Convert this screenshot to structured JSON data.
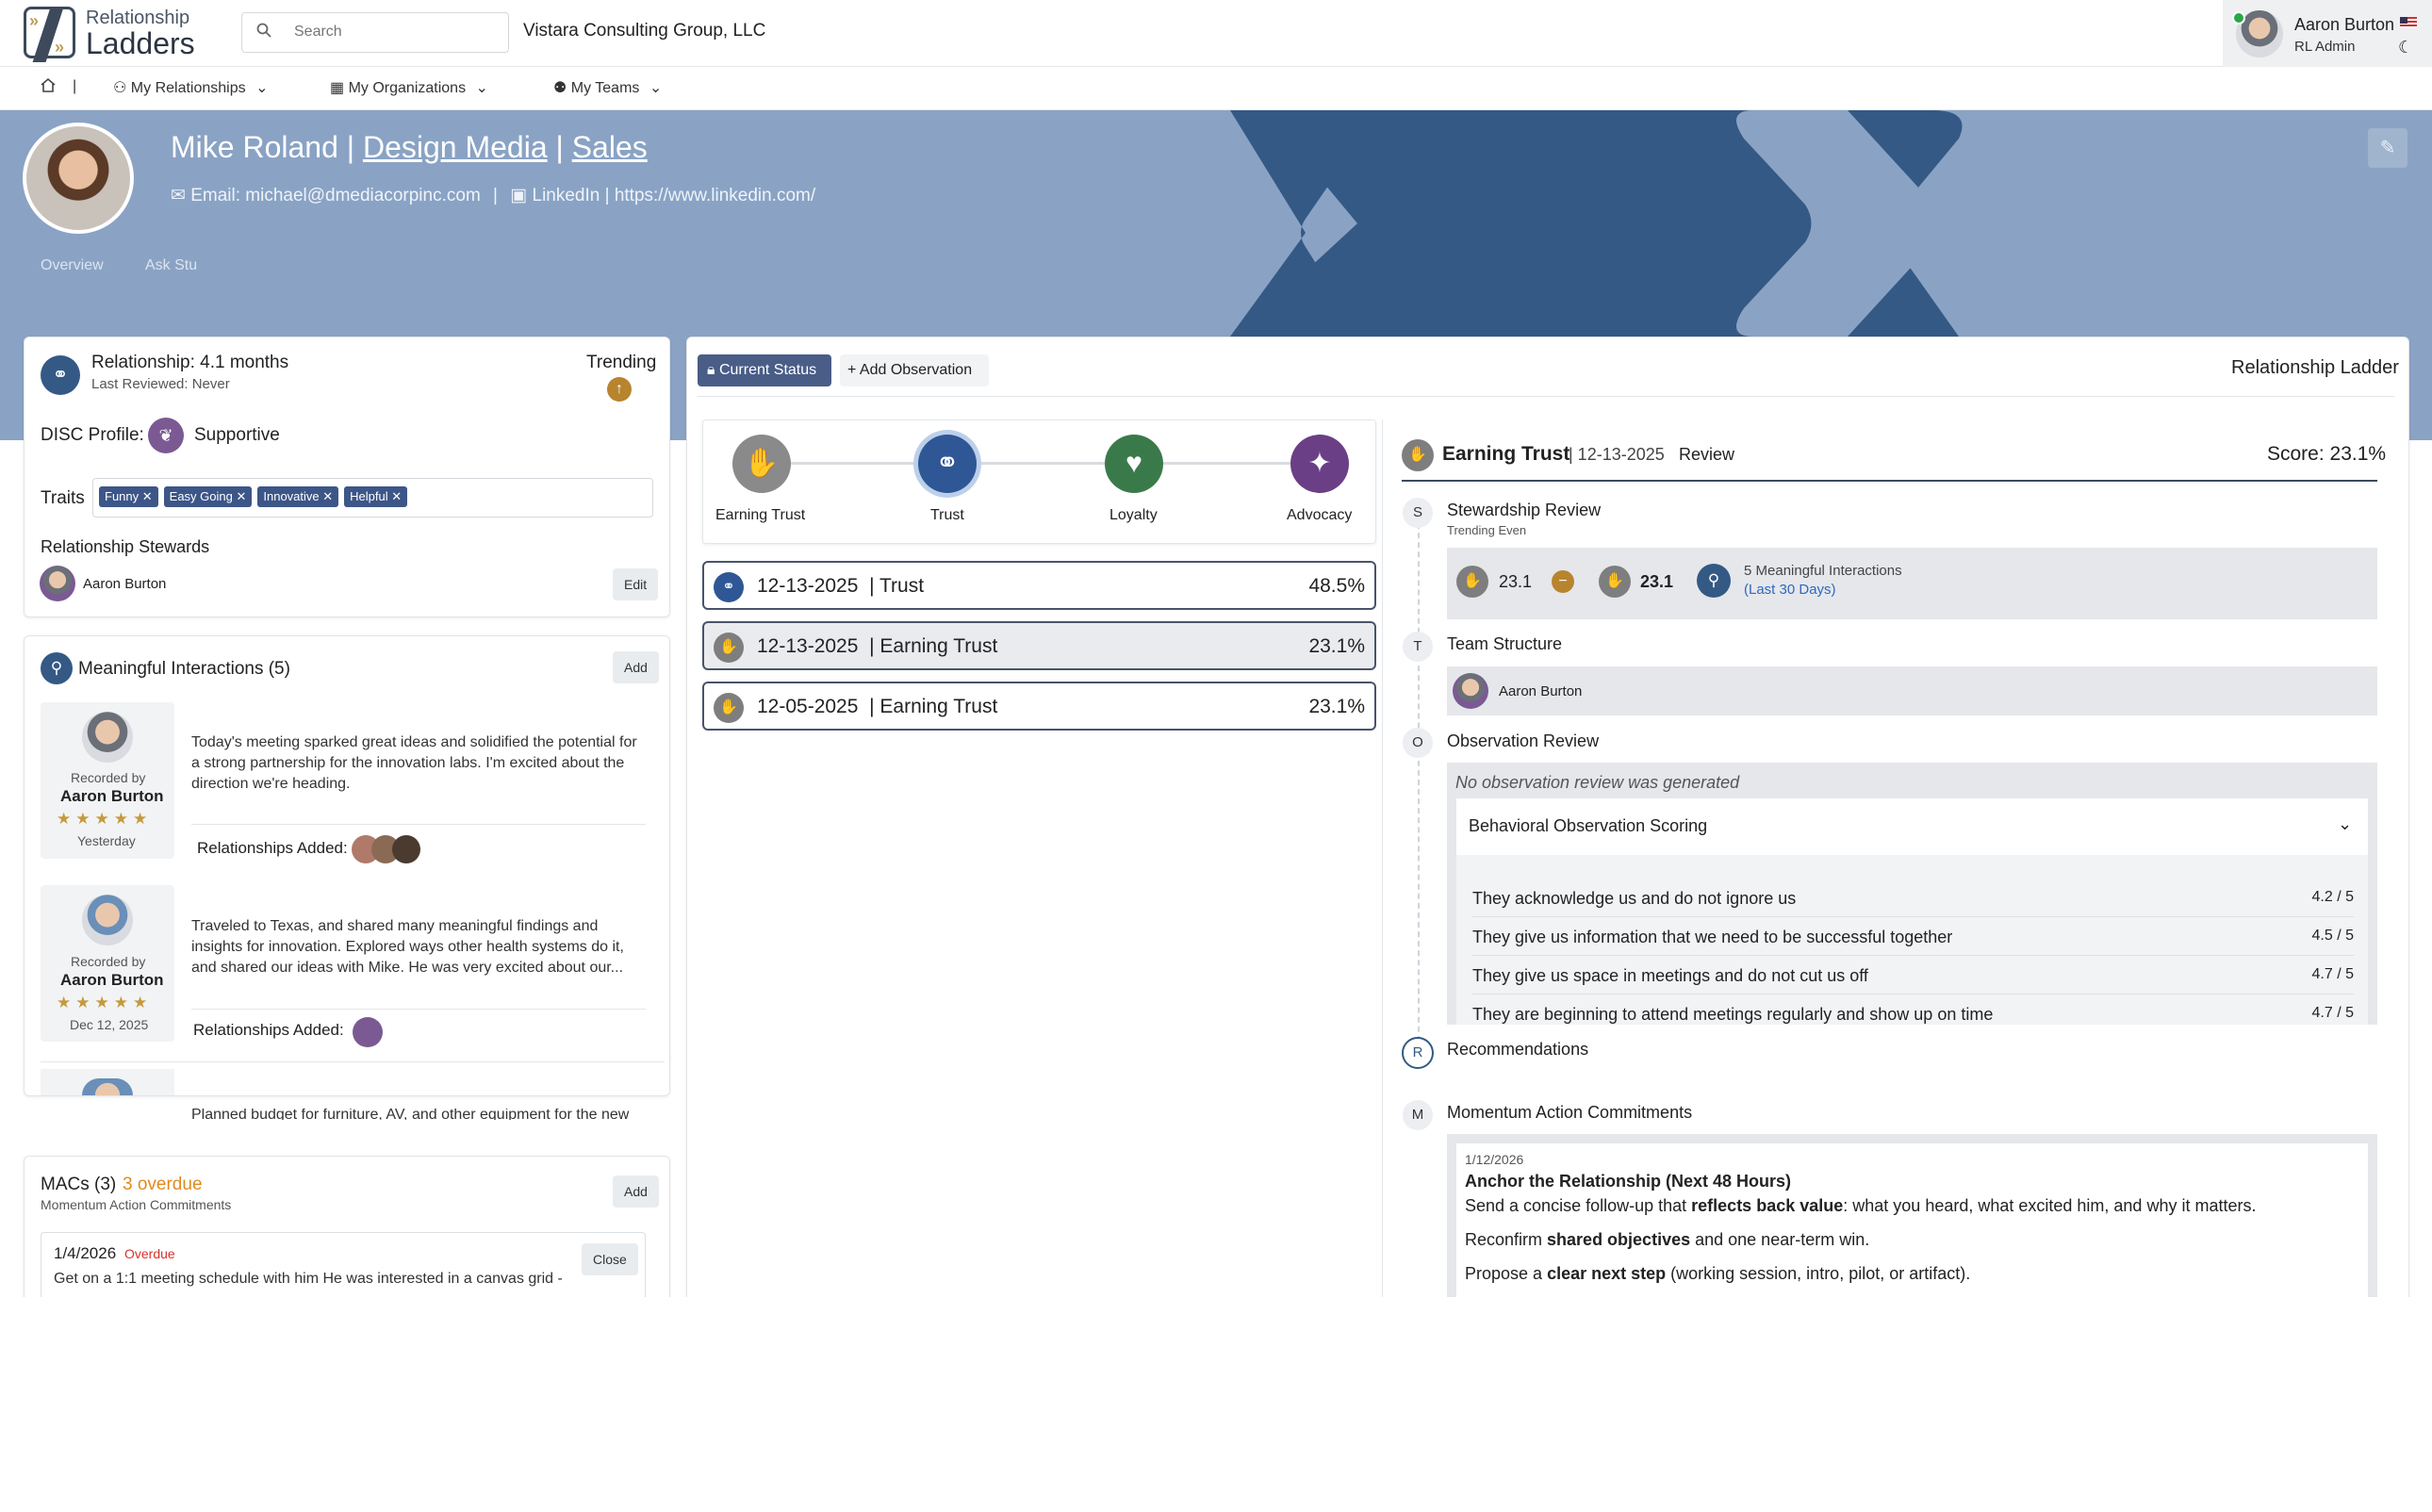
{
  "app": {
    "logo_line1": "Relationship",
    "logo_line2": "Ladders"
  },
  "search": {
    "placeholder": "Search"
  },
  "org_name": "Vistara Consulting Group, LLC",
  "user": {
    "name": "Aaron Burton",
    "role": "RL Admin"
  },
  "nav": {
    "separator": "|",
    "items": [
      "My Relationships",
      "My Organizations",
      "My Teams"
    ]
  },
  "profile": {
    "name": "Mike Roland",
    "company": "Design Media",
    "department": "Sales",
    "email": "Email: michael@dmediacorpinc.com",
    "linkedin": "LinkedIn | https://www.linkedin.com/",
    "tabs": [
      "Overview",
      "Ask Stu"
    ]
  },
  "summary": {
    "relationship": "Relationship: 4.1 months",
    "last_reviewed": "Last Reviewed: Never",
    "trending": "Trending",
    "disc_label": "DISC Profile:",
    "disc_value": "Supportive",
    "traits_label": "Traits",
    "traits": [
      "Funny",
      "Easy Going",
      "Innovative",
      "Helpful"
    ],
    "stewards_label": "Relationship Stewards",
    "steward": "Aaron Burton",
    "edit": "Edit"
  },
  "interactions": {
    "title": "Meaningful Interactions (5)",
    "add": "Add",
    "items": [
      {
        "recorded_by": "Recorded by",
        "author": "Aaron Burton",
        "stars": "★★★★★",
        "date": "Yesterday",
        "text": "Today's meeting sparked great ideas and solidified the potential for a strong partnership for the innovation labs. I'm excited about the direction we're heading.",
        "rel_label": "Relationships Added:"
      },
      {
        "recorded_by": "Recorded by",
        "author": "Aaron Burton",
        "stars": "★★★★★",
        "date": "Dec 12, 2025",
        "text": "Traveled to Texas, and shared many meaningful findings and insights for innovation. Explored ways other health systems do it, and shared our ideas with Mike. He was very excited about our...",
        "rel_label": "Relationships Added:"
      },
      {
        "text": "Planned budget for furniture, AV, and other equipment for the new"
      }
    ]
  },
  "macs": {
    "title": "MACs (3)",
    "overdue_count": "3 overdue",
    "subtitle": "Momentum Action Commitments",
    "add": "Add",
    "item_date": "1/4/2026",
    "item_status": "Overdue",
    "item_text": "Get on a 1:1 meeting schedule with him He was interested in a canvas grid -",
    "close": "Close"
  },
  "ladder": {
    "current_status": "Current Status",
    "add_observation": "Add Observation",
    "title": "Relationship Ladder",
    "stages": [
      "Earning Trust",
      "Trust",
      "Loyalty",
      "Advocacy"
    ],
    "history": [
      {
        "date": "12-13-2025",
        "stage": "| Trust",
        "pct": "48.5%"
      },
      {
        "date": "12-13-2025",
        "stage": "| Earning Trust",
        "pct": "23.1%"
      },
      {
        "date": "12-05-2025",
        "stage": "| Earning Trust",
        "pct": "23.1%"
      }
    ]
  },
  "review": {
    "stage": "Earning Trust",
    "date": "| 12-13-2025",
    "type": "Review",
    "score": "Score: 23.1%",
    "stewardship_title": "Stewardship Review",
    "stewardship_sub": "Trending Even",
    "score_prev": "23.1",
    "score_curr": "23.1",
    "interactions_count": "5 Meaningful Interactions",
    "interactions_period": "(Last 30 Days)",
    "team_title": "Team Structure",
    "team_member": "Aaron Burton",
    "observation_title": "Observation Review",
    "observation_note": "No observation review was generated",
    "scoring_title": "Behavioral Observation Scoring",
    "scores": [
      {
        "q": "They acknowledge us and do not ignore us",
        "v": "4.2 / 5"
      },
      {
        "q": "They give us information that we need to be successful together",
        "v": "4.5 / 5"
      },
      {
        "q": "They give us space in meetings and do not cut us off",
        "v": "4.7 / 5"
      },
      {
        "q": "They are beginning to attend meetings regularly and show up on time",
        "v": "4.7 / 5"
      }
    ],
    "recommendations_title": "Recommendations",
    "momentum_title": "Momentum Action Commitments",
    "mac_date": "1/12/2026",
    "mac_heading": "Anchor the Relationship (Next 48 Hours)",
    "mac_line1_a": "Send a concise follow-up that ",
    "mac_line1_b": "reflects back value",
    "mac_line1_c": ": what you heard, what excited him, and why it matters.",
    "mac_line2_a": "Reconfirm ",
    "mac_line2_b": "shared objectives",
    "mac_line2_c": " and one near-term win.",
    "mac_line3_a": "Propose a ",
    "mac_line3_b": "clear next step",
    "mac_line3_c": " (working session, intro, pilot, or artifact).",
    "letters": [
      "S",
      "T",
      "O",
      "R",
      "M"
    ]
  },
  "colors": {
    "banner": "#8aa3c4",
    "chevron": "#345985",
    "accent": "#3c5688",
    "overdue": "#e08a1e",
    "trust": "#2f5796",
    "loyalty": "#3a7a4a",
    "advocacy": "#6b3f86",
    "earning": "#8a8a8a"
  }
}
